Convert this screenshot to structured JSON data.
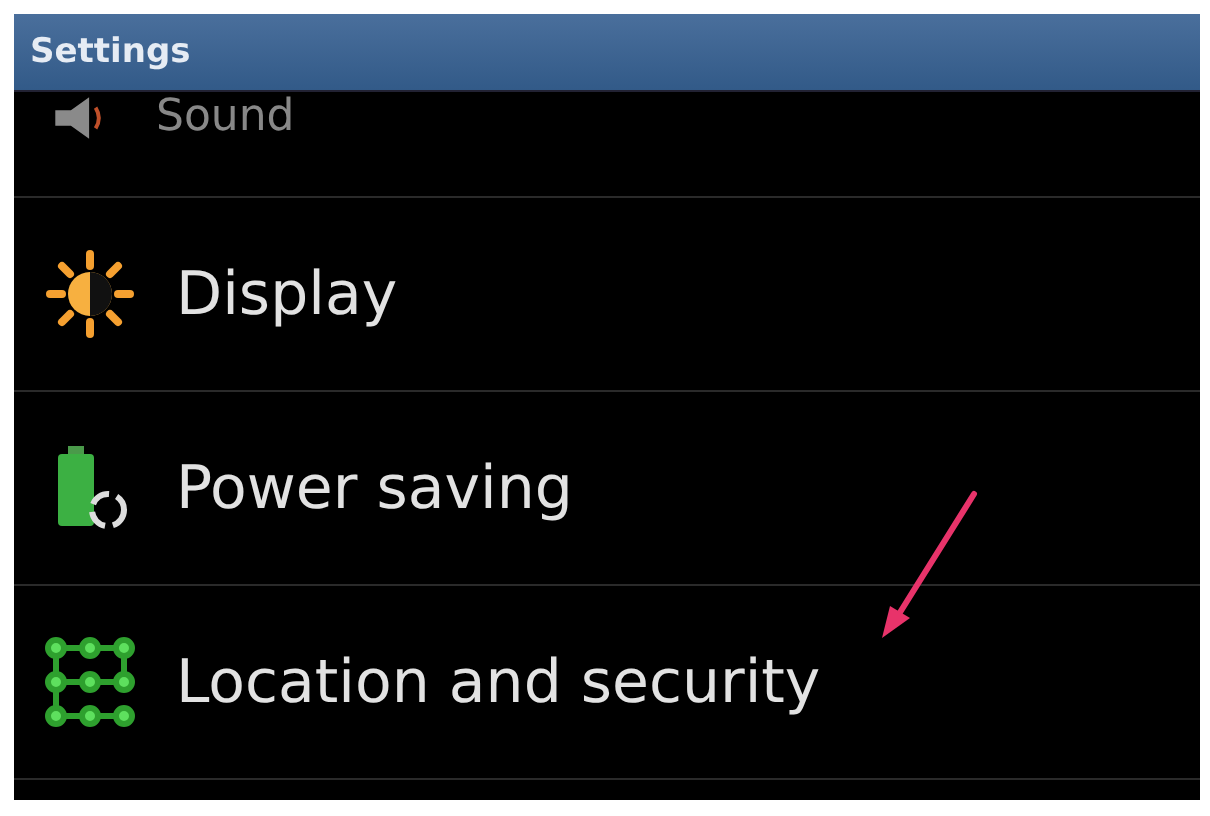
{
  "window": {
    "title": "Settings"
  },
  "items": [
    {
      "label": "Sound",
      "kind": "sound"
    },
    {
      "label": "Display",
      "kind": "display"
    },
    {
      "label": "Power saving",
      "kind": "power"
    },
    {
      "label": "Location and security",
      "kind": "location"
    }
  ]
}
